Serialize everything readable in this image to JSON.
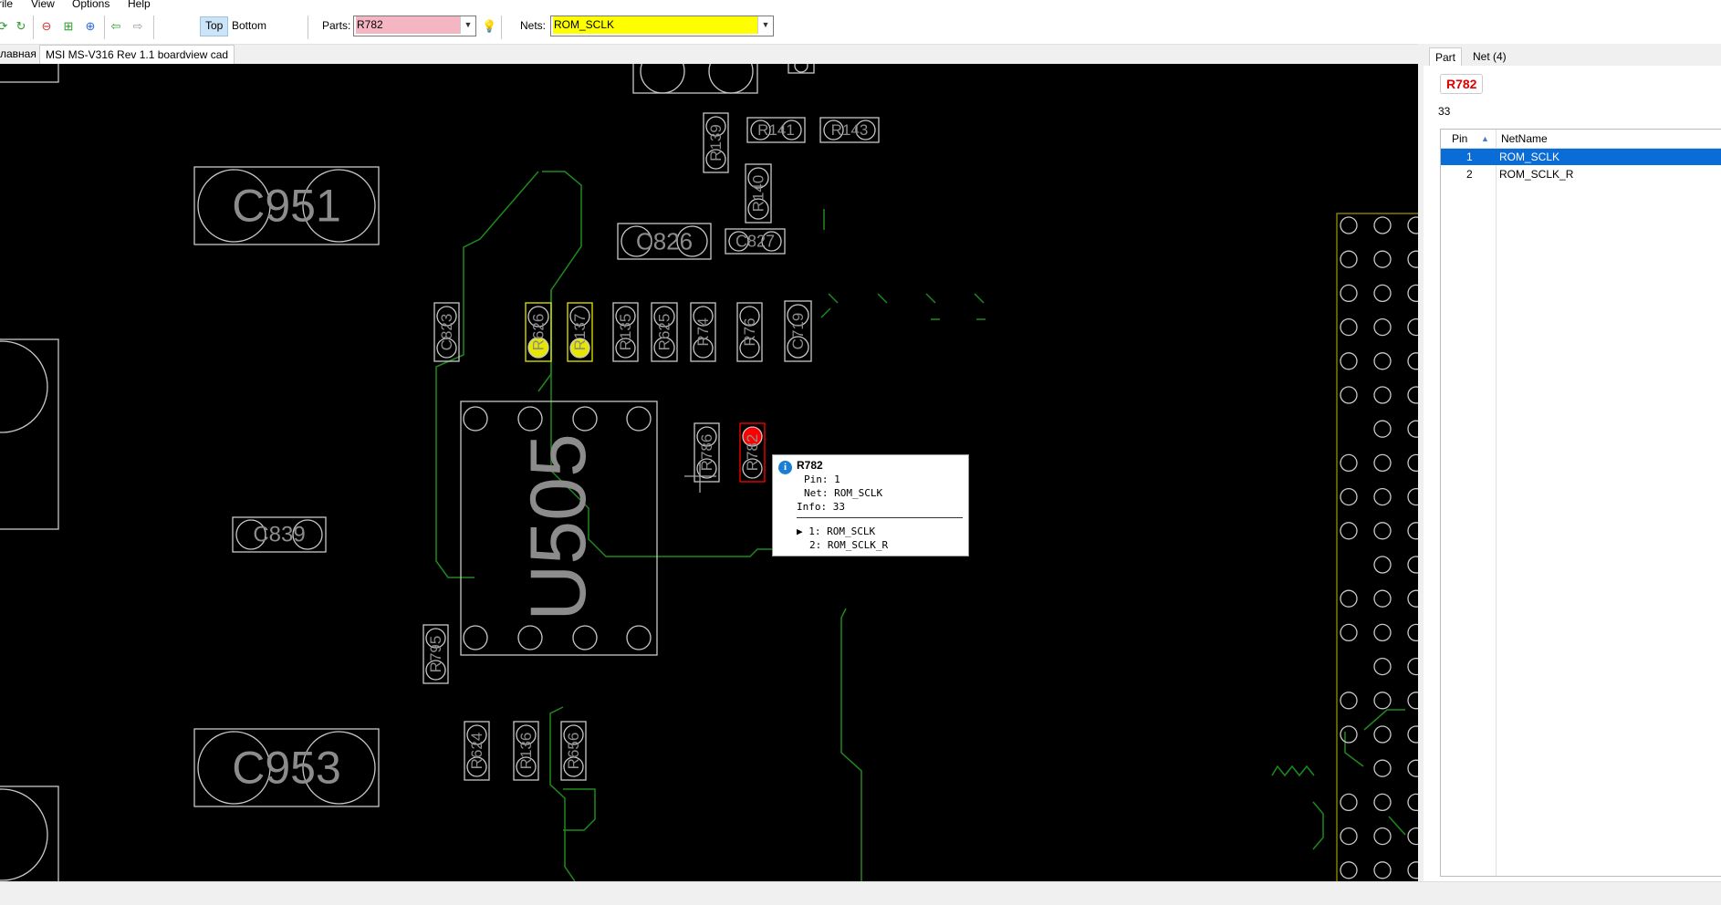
{
  "menu": {
    "items": [
      "rile",
      "View",
      "Options",
      "Help"
    ]
  },
  "toolbar": {
    "layer_top": "Top",
    "layer_bottom": "Bottom",
    "parts_label": "Parts:",
    "parts_value": "R782",
    "nets_label": "Nets:",
    "nets_value": "ROM_SCLK",
    "icons": [
      "refresh-icon",
      "reload-icon",
      "zoom-out-icon",
      "zoom-fit-icon",
      "zoom-in-icon",
      "back-arrow-icon",
      "forward-arrow-icon",
      "bulb-icon"
    ]
  },
  "tabs": [
    {
      "label": "лавная"
    },
    {
      "label": "MSI MS-V316 Rev 1.1 boardview cad"
    }
  ],
  "board": {
    "parts": {
      "c951": "C951",
      "c953": "C953",
      "c839": "C839",
      "c826": "C826",
      "c827": "C827",
      "u505": "U505",
      "r141": "R141",
      "r143": "R143",
      "r139": "R139",
      "r140": "R140",
      "c823": "C823",
      "r626": "R626",
      "r137": "R137",
      "r135": "R135",
      "r625": "R625",
      "r74": "R74",
      "r76": "R76",
      "c719": "C719",
      "r786": "R786",
      "r782": "R782",
      "r795": "R795",
      "r624": "R624",
      "r136": "R136",
      "r656": "R656"
    },
    "colors": {
      "background": "#000000",
      "outline": "#c8c8c8",
      "trace": "#1e8a1e",
      "highlight_net": "#e6e600",
      "selected_part": "#ff0000"
    }
  },
  "tooltip": {
    "title": "R782",
    "pin_line": "Pin: 1",
    "net_line": "Net: ROM_SCLK",
    "info_line": "Info: 33",
    "pin1_line": "▶ 1: ROM_SCLK",
    "pin2_line": "2: ROM_SCLK_R"
  },
  "sidebar": {
    "tabs": [
      "Part",
      "Net (4)"
    ],
    "part_name": "R782",
    "part_info": "33",
    "columns": [
      "Pin",
      "NetName"
    ],
    "rows": [
      {
        "pin": "1",
        "net": "ROM_SCLK"
      },
      {
        "pin": "2",
        "net": "ROM_SCLK_R"
      }
    ]
  }
}
